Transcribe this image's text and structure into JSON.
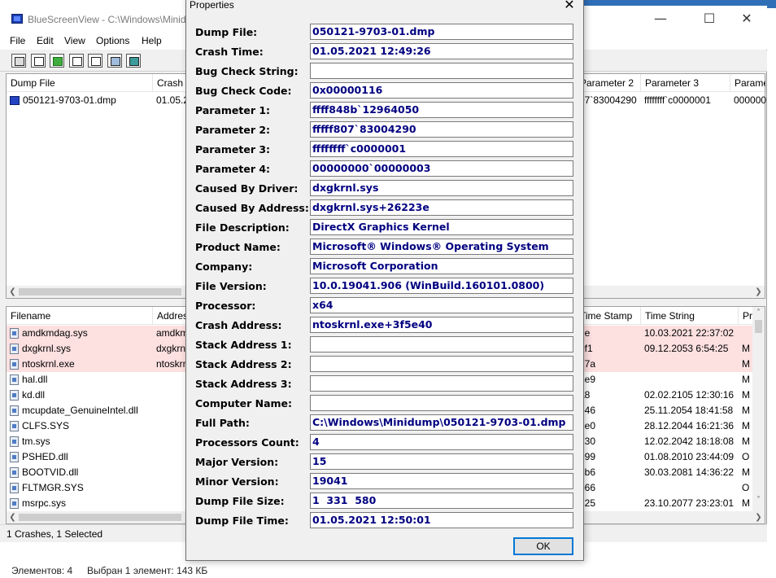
{
  "main": {
    "title": "BlueScreenView  -  C:\\Windows\\Minidump",
    "menu": [
      "File",
      "Edit",
      "View",
      "Options",
      "Help"
    ],
    "toolbar_icons": [
      "properties-icon",
      "save-icon",
      "refresh-icon",
      "copy-icon",
      "report-icon",
      "find-icon",
      "exit-icon"
    ],
    "upper_columns": [
      "Dump File",
      "Crash Time",
      "Parameter 2",
      "Parameter 3",
      "Parameter 4"
    ],
    "upper_row": {
      "dump_file": "050121-9703-01.dmp",
      "crash_time": "01.05.2",
      "param2": "07`83004290",
      "param3": "ffffffff`c0000001",
      "param4": "0000000"
    },
    "lower_columns": [
      "Filename",
      "Address",
      "Time Stamp",
      "Time String",
      "Product"
    ],
    "lower_rows": [
      {
        "filename": "amdkmdag.sys",
        "address": "amdkm",
        "stamp": "de",
        "time": "10.03.2021 22:37:02",
        "product": "",
        "highlight": true
      },
      {
        "filename": "dxgkrnl.sys",
        "address": "dxgkrn",
        "stamp": "9f1",
        "time": "09.12.2053 6:54:25",
        "product": "M",
        "highlight": true
      },
      {
        "filename": "ntoskrnl.exe",
        "address": "ntoskrn",
        "stamp": "77a",
        "time": "",
        "product": "M",
        "highlight": true
      },
      {
        "filename": "hal.dll",
        "address": "",
        "stamp": "3e9",
        "time": "",
        "product": "M",
        "highlight": false
      },
      {
        "filename": "kd.dll",
        "address": "",
        "stamp": "a8",
        "time": "02.02.2105 12:30:16",
        "product": "M",
        "highlight": false
      },
      {
        "filename": "mcupdate_GenuineIntel.dll",
        "address": "",
        "stamp": "e46",
        "time": "25.11.2054 18:41:58",
        "product": "M",
        "highlight": false
      },
      {
        "filename": "CLFS.SYS",
        "address": "",
        "stamp": "3e0",
        "time": "28.12.2044 16:21:36",
        "product": "M",
        "highlight": false
      },
      {
        "filename": "tm.sys",
        "address": "",
        "stamp": "d30",
        "time": "12.02.2042 18:18:08",
        "product": "M",
        "highlight": false
      },
      {
        "filename": "PSHED.dll",
        "address": "",
        "stamp": "e99",
        "time": "01.08.2010 23:44:09",
        "product": "O",
        "highlight": false
      },
      {
        "filename": "BOOTVID.dll",
        "address": "",
        "stamp": "5b6",
        "time": "30.03.2081 14:36:22",
        "product": "M",
        "highlight": false
      },
      {
        "filename": "FLTMGR.SYS",
        "address": "",
        "stamp": "b66",
        "time": "",
        "product": "O",
        "highlight": false
      },
      {
        "filename": "msrpc.sys",
        "address": "",
        "stamp": "325",
        "time": "23.10.2077 23:23:01",
        "product": "M",
        "highlight": false
      }
    ],
    "status": "1 Crashes, 1 Selected"
  },
  "explorer_status": {
    "items": "Элементов: 4",
    "selected": "Выбран 1 элемент: 143 КБ"
  },
  "dialog": {
    "title": "Properties",
    "ok_label": "OK",
    "props": [
      {
        "label": "Dump File:",
        "value": "050121-9703-01.dmp"
      },
      {
        "label": "Crash Time:",
        "value": "01.05.2021 12:49:26"
      },
      {
        "label": "Bug Check String:",
        "value": ""
      },
      {
        "label": "Bug Check Code:",
        "value": "0x00000116"
      },
      {
        "label": "Parameter 1:",
        "value": "ffff848b`12964050"
      },
      {
        "label": "Parameter 2:",
        "value": "fffff807`83004290"
      },
      {
        "label": "Parameter 3:",
        "value": "ffffffff`c0000001"
      },
      {
        "label": "Parameter 4:",
        "value": "00000000`00000003"
      },
      {
        "label": "Caused By Driver:",
        "value": "dxgkrnl.sys"
      },
      {
        "label": "Caused By Address:",
        "value": "dxgkrnl.sys+26223e"
      },
      {
        "label": "File Description:",
        "value": "DirectX Graphics Kernel"
      },
      {
        "label": "Product Name:",
        "value": "Microsoft® Windows® Operating System"
      },
      {
        "label": "Company:",
        "value": "Microsoft Corporation"
      },
      {
        "label": "File Version:",
        "value": "10.0.19041.906 (WinBuild.160101.0800)"
      },
      {
        "label": "Processor:",
        "value": "x64"
      },
      {
        "label": "Crash Address:",
        "value": "ntoskrnl.exe+3f5e40"
      },
      {
        "label": "Stack Address 1:",
        "value": ""
      },
      {
        "label": "Stack Address 2:",
        "value": ""
      },
      {
        "label": "Stack Address 3:",
        "value": ""
      },
      {
        "label": "Computer Name:",
        "value": ""
      },
      {
        "label": "Full Path:",
        "value": "C:\\Windows\\Minidump\\050121-9703-01.dmp"
      },
      {
        "label": "Processors Count:",
        "value": "4"
      },
      {
        "label": "Major Version:",
        "value": "15"
      },
      {
        "label": "Minor Version:",
        "value": "19041"
      },
      {
        "label": "Dump File Size:",
        "value": "1  331  580"
      },
      {
        "label": "Dump File Time:",
        "value": "01.05.2021 12:50:01"
      }
    ]
  }
}
